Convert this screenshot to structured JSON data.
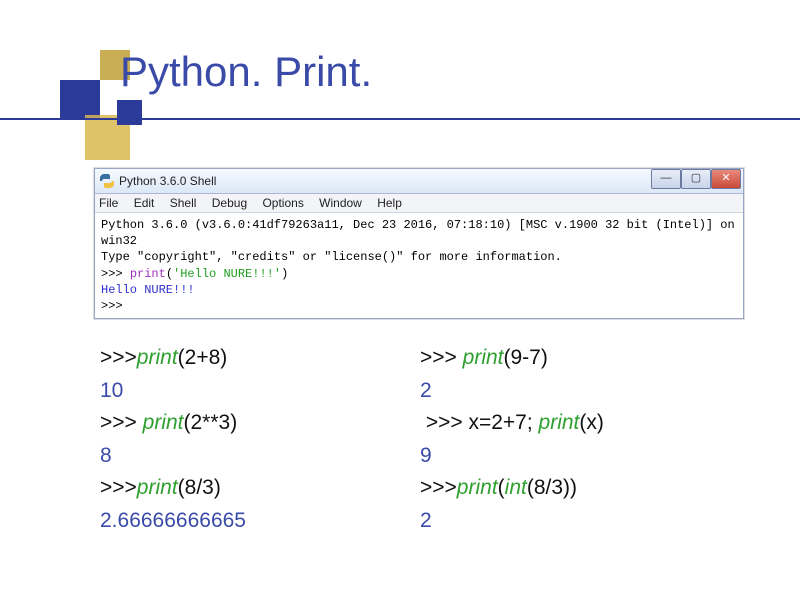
{
  "title": "Python. Print.",
  "shell": {
    "window_title": "Python 3.6.0 Shell",
    "menus": [
      "File",
      "Edit",
      "Shell",
      "Debug",
      "Options",
      "Window",
      "Help"
    ],
    "banner_line1": "Python 3.6.0 (v3.6.0:41df79263a11, Dec 23 2016, 07:18:10) [MSC v.1900 32 bit (Intel)] on win32",
    "banner_line2": "Type \"copyright\", \"credits\" or \"license()\" for more information.",
    "prompt": ">>>",
    "input_cmd": "print",
    "input_arg": "'Hello NURE!!!'",
    "output": "Hello NURE!!!",
    "win_min": "—",
    "win_max": "▢",
    "win_close": "✕"
  },
  "examples": {
    "left": [
      {
        "prompt": ">>>",
        "fn": "print",
        "args": "(2+8)",
        "result": "10"
      },
      {
        "prompt": ">>> ",
        "fn": "print",
        "args": "(2**3)",
        "result": "8"
      },
      {
        "prompt": ">>>",
        "fn": "print",
        "args": "(8/3)",
        "result": "2.66666666665"
      }
    ],
    "right": [
      {
        "prompt": ">>> ",
        "fn": "print",
        "args": "(9-7)",
        "result": "2"
      },
      {
        "prompt": " >>> x=2+7; ",
        "fn": "print",
        "args": "(x)",
        "result": "9"
      },
      {
        "prompt": ">>>",
        "fn": "print",
        "args_pre": "(",
        "fn2": "int",
        "args2": "(8/3))",
        "result": "2"
      }
    ]
  }
}
